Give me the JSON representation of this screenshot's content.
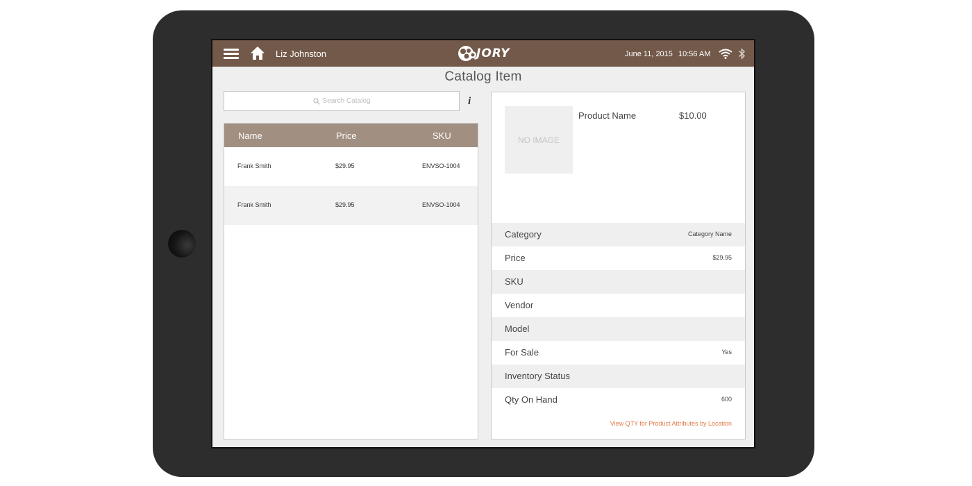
{
  "header": {
    "user_name": "Liz Johnston",
    "logo_text": "JORY",
    "date": "June 11, 2015",
    "time": "10:56 AM"
  },
  "page": {
    "title": "Catalog Item"
  },
  "search": {
    "placeholder": "Search Catalog"
  },
  "catalog_table": {
    "columns": [
      "Name",
      "Price",
      "SKU"
    ],
    "rows": [
      {
        "name": "Frank Smith",
        "price": "$29.95",
        "sku": "ENVSO-1004"
      },
      {
        "name": "Frank Smith",
        "price": "$29.95",
        "sku": "ENVSO-1004"
      }
    ]
  },
  "detail": {
    "no_image_text": "NO IMAGE",
    "product_name": "Product Name",
    "product_price": "$10.00",
    "attributes": [
      {
        "label": "Category",
        "value": "Category Name"
      },
      {
        "label": "Price",
        "value": "$29.95"
      },
      {
        "label": "SKU",
        "value": ""
      },
      {
        "label": "Vendor",
        "value": ""
      },
      {
        "label": "Model",
        "value": ""
      },
      {
        "label": "For Sale",
        "value": "Yes"
      },
      {
        "label": "Inventory Status",
        "value": ""
      },
      {
        "label": "Qty On Hand",
        "value": "600"
      }
    ],
    "qty_link": "View QTY for Product Attributes by Location"
  },
  "colors": {
    "topbar": "#73594a",
    "table_header": "#a18f82",
    "link": "#e07c4a",
    "device_frame": "#2d2d2d"
  },
  "icons": [
    "hamburger-menu-icon",
    "home-icon",
    "jory-logo-icon",
    "wifi-icon",
    "bluetooth-icon",
    "search-icon",
    "info-icon"
  ]
}
